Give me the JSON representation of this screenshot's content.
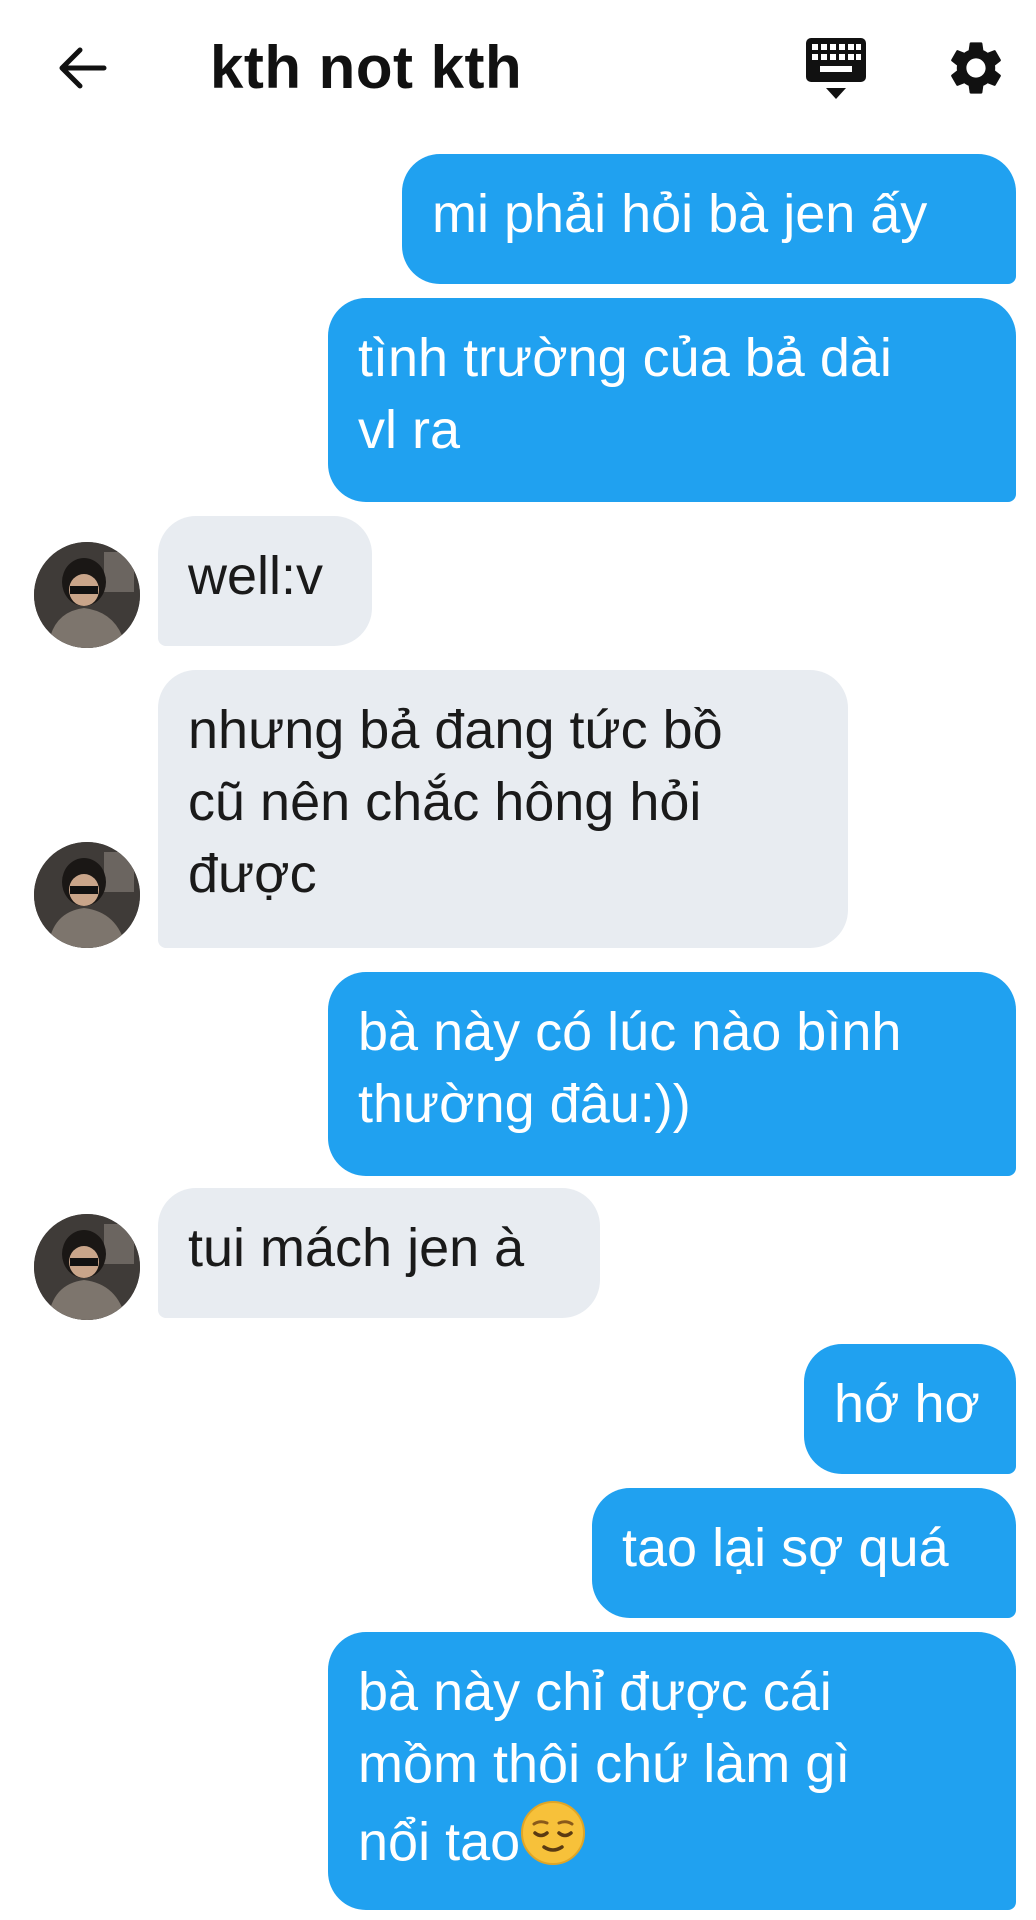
{
  "header": {
    "title": "kth not kth",
    "back_icon": "back-arrow-icon",
    "keyboard_icon": "keyboard-icon",
    "settings_icon": "gear-icon"
  },
  "colors": {
    "outgoing_bubble": "#20a1f0",
    "incoming_bubble": "#e8ecf1"
  },
  "messages": [
    {
      "side": "out",
      "lines": [
        "mi phải hỏi bà jen ấy"
      ]
    },
    {
      "side": "out",
      "lines": [
        "tình trường của bả dài",
        "vl ra"
      ]
    },
    {
      "side": "in",
      "lines": [
        "well:v"
      ]
    },
    {
      "side": "in",
      "lines": [
        "nhưng bả đang tức bồ",
        "cũ nên chắc hông hỏi",
        "được"
      ]
    },
    {
      "side": "out",
      "lines": [
        "bà này có lúc nào bình",
        "thường đâu:))"
      ]
    },
    {
      "side": "in",
      "lines": [
        "tui mách jen à"
      ]
    },
    {
      "side": "out",
      "lines": [
        "hớ hơ"
      ]
    },
    {
      "side": "out",
      "lines": [
        "tao lại sợ quá"
      ]
    },
    {
      "side": "out",
      "lines": [
        "bà này chỉ được cái",
        "mồm thôi chứ làm gì",
        "nổi tao"
      ],
      "emoji": "relieved-face-emoji"
    }
  ]
}
